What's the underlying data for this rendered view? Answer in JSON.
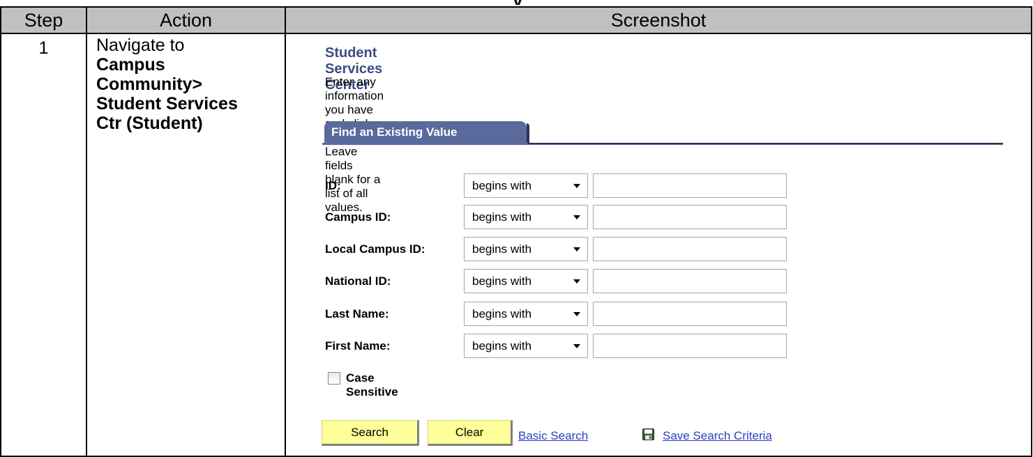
{
  "top_fragment": "y",
  "table": {
    "headers": {
      "step": "Step",
      "action": "Action",
      "screenshot": "Screenshot"
    },
    "row": {
      "step": "1",
      "action": {
        "intro": "Navigate to",
        "path_lines": [
          "Campus",
          "Community>",
          "Student Services",
          "Ctr (Student)"
        ]
      }
    }
  },
  "screen": {
    "title": "Student Services Center",
    "instructions": "Enter any information you have and click Search. Leave fields blank for a list of all values.",
    "tab_label": "Find an Existing Value",
    "fields": [
      {
        "label": "ID:",
        "operator": "begins with",
        "value": ""
      },
      {
        "label": "Campus ID:",
        "operator": "begins with",
        "value": ""
      },
      {
        "label": "Local Campus ID:",
        "operator": "begins with",
        "value": ""
      },
      {
        "label": "National ID:",
        "operator": "begins with",
        "value": ""
      },
      {
        "label": "Last Name:",
        "operator": "begins with",
        "value": ""
      },
      {
        "label": "First Name:",
        "operator": "begins with",
        "value": ""
      }
    ],
    "case_sensitive": {
      "label": "Case Sensitive",
      "checked": false
    },
    "buttons": {
      "search": "Search",
      "clear": "Clear"
    },
    "links": {
      "basic_search": "Basic Search",
      "save_criteria": "Save Search Criteria"
    },
    "colors": {
      "title": "#3e4e84",
      "tab": "#5a6a9c",
      "button": "#ffff99",
      "link": "#2b3fbf",
      "header_bg": "#c0c0c0"
    },
    "icons": {
      "save": "floppy-disk-icon",
      "dropdown": "chevron-down-icon"
    }
  }
}
